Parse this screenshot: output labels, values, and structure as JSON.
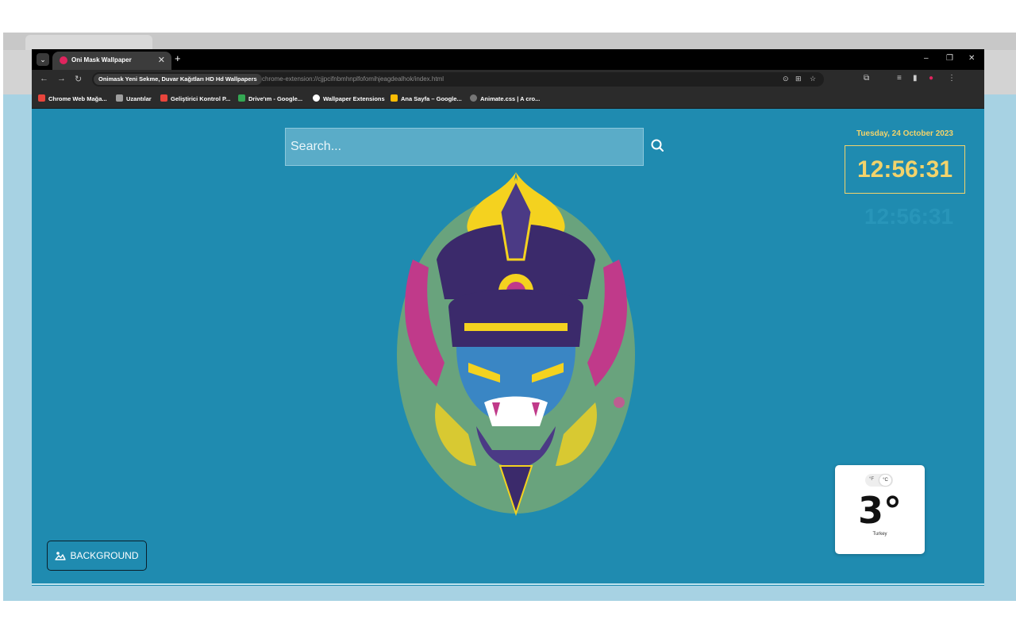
{
  "browser": {
    "tab_title": "Oni Mask Wallpaper",
    "page_title": "Onimask Yeni Sekme, Duvar Kağıtları HD Hd Wallpapers",
    "url": "chrome-extension://cjjpcifnbmhnplfofomihjeagdealhok/index.html",
    "bookmarks": [
      {
        "label": "Chrome Web Mağa...",
        "color": "#e8453c"
      },
      {
        "label": "Uzantılar",
        "color": "#9e9e9e"
      },
      {
        "label": "Geliştirici Kontrol P...",
        "color": "#e8453c"
      },
      {
        "label": "Drive'ım - Google...",
        "color": "#34a853"
      },
      {
        "label": "Wallpaper Extensions",
        "color": "#ffffff"
      },
      {
        "label": "Ana Sayfa – Google...",
        "color": "#fbbc04"
      },
      {
        "label": "Animate.css | A cro...",
        "color": "#777777"
      }
    ]
  },
  "search": {
    "placeholder": "Search..."
  },
  "clock": {
    "date": "Tuesday, 24 October 2023",
    "time": "12:56:31"
  },
  "weather": {
    "unit_f": "°F",
    "unit_c": "°C",
    "temperature": "3°",
    "location": "Turkey"
  },
  "background_button": {
    "label": "BACKGROUND"
  },
  "colors": {
    "page_bg": "#1f8bb0",
    "clock_accent": "#f2d36b"
  },
  "icons": [
    "search-icon",
    "landscape-icon",
    "star-icon",
    "reload-icon",
    "back-icon",
    "forward-icon",
    "menu-icon"
  ]
}
